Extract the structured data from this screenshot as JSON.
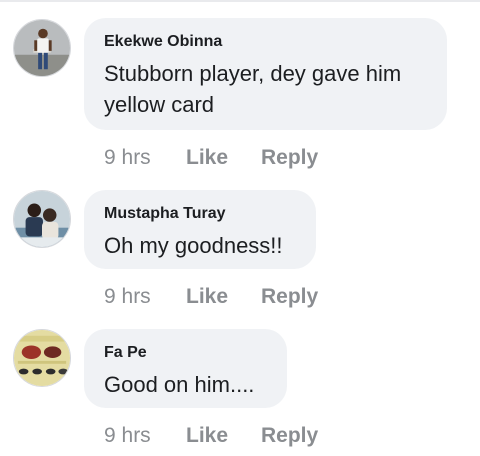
{
  "comments": [
    {
      "author": "Ekekwe Obinna",
      "text": "Stubborn  player, dey gave him yellow card",
      "time": "9 hrs",
      "like_label": "Like",
      "reply_label": "Reply"
    },
    {
      "author": "Mustapha Turay",
      "text": "Oh my goodness!!",
      "time": "9 hrs",
      "like_label": "Like",
      "reply_label": "Reply"
    },
    {
      "author": "Fa Pe",
      "text": "Good on him....",
      "time": "9 hrs",
      "like_label": "Like",
      "reply_label": "Reply"
    }
  ],
  "colors": {
    "bubble": "#f0f2f5",
    "text": "#1c1e21",
    "meta": "#8a8d91"
  }
}
